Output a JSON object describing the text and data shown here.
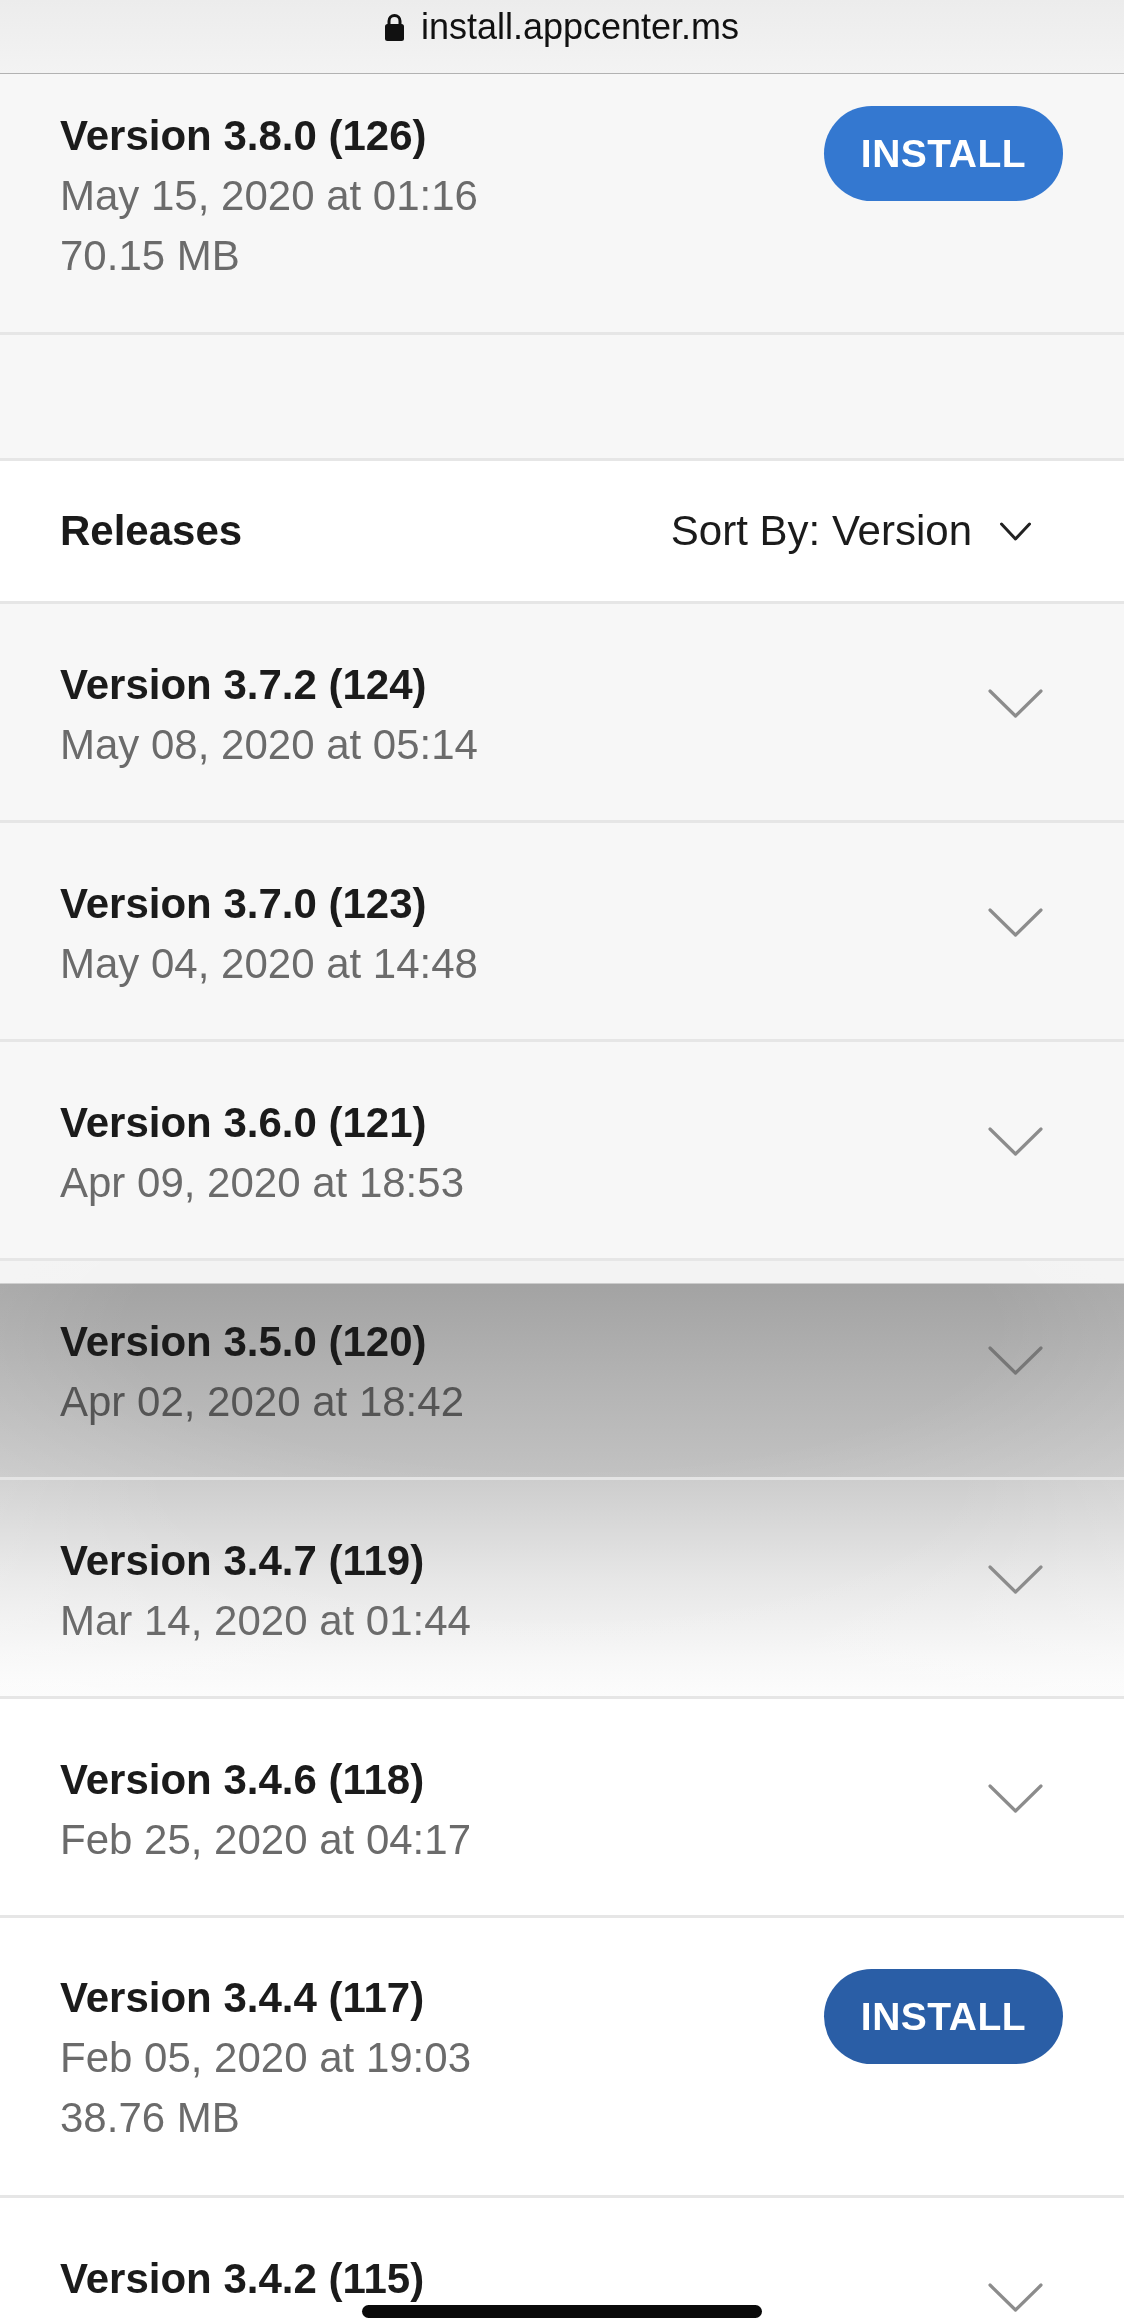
{
  "address_bar": {
    "url": "install.appcenter.ms"
  },
  "latest_release": {
    "title": "Version 3.8.0 (126)",
    "date": "May 15, 2020 at 01:16",
    "size": "70.15 MB",
    "install_button": {
      "label": "INSTALL",
      "pressed": false
    }
  },
  "releases_header": {
    "title": "Releases",
    "sort": "Sort By: Version"
  },
  "releases": [
    {
      "title": "Version 3.7.2 (124)",
      "date": "May 08, 2020 at 05:14",
      "expanded": false,
      "highlighted": false
    },
    {
      "title": "Version 3.7.0 (123)",
      "date": "May 04, 2020 at 14:48",
      "expanded": false,
      "highlighted": false
    },
    {
      "title": "Version 3.6.0 (121)",
      "date": "Apr 09, 2020 at 18:53",
      "expanded": false,
      "highlighted": false
    },
    {
      "title": "Version 3.5.0 (120)",
      "date": "Apr 02, 2020 at 18:42",
      "expanded": false,
      "highlighted": true
    },
    {
      "title": "Version 3.4.7 (119)",
      "date": "Mar 14, 2020 at 01:44",
      "expanded": false,
      "highlighted": false
    },
    {
      "title": "Version 3.4.6 (118)",
      "date": "Feb 25, 2020 at 04:17",
      "expanded": false,
      "highlighted": false
    },
    {
      "title": "Version 3.4.4 (117)",
      "date": "Feb 05, 2020 at 19:03",
      "size": "38.76 MB",
      "expanded": true,
      "highlighted": false,
      "install_button": {
        "label": "INSTALL",
        "pressed": true
      }
    },
    {
      "title": "Version 3.4.2 (115)",
      "expanded": false,
      "highlighted": false
    }
  ]
}
